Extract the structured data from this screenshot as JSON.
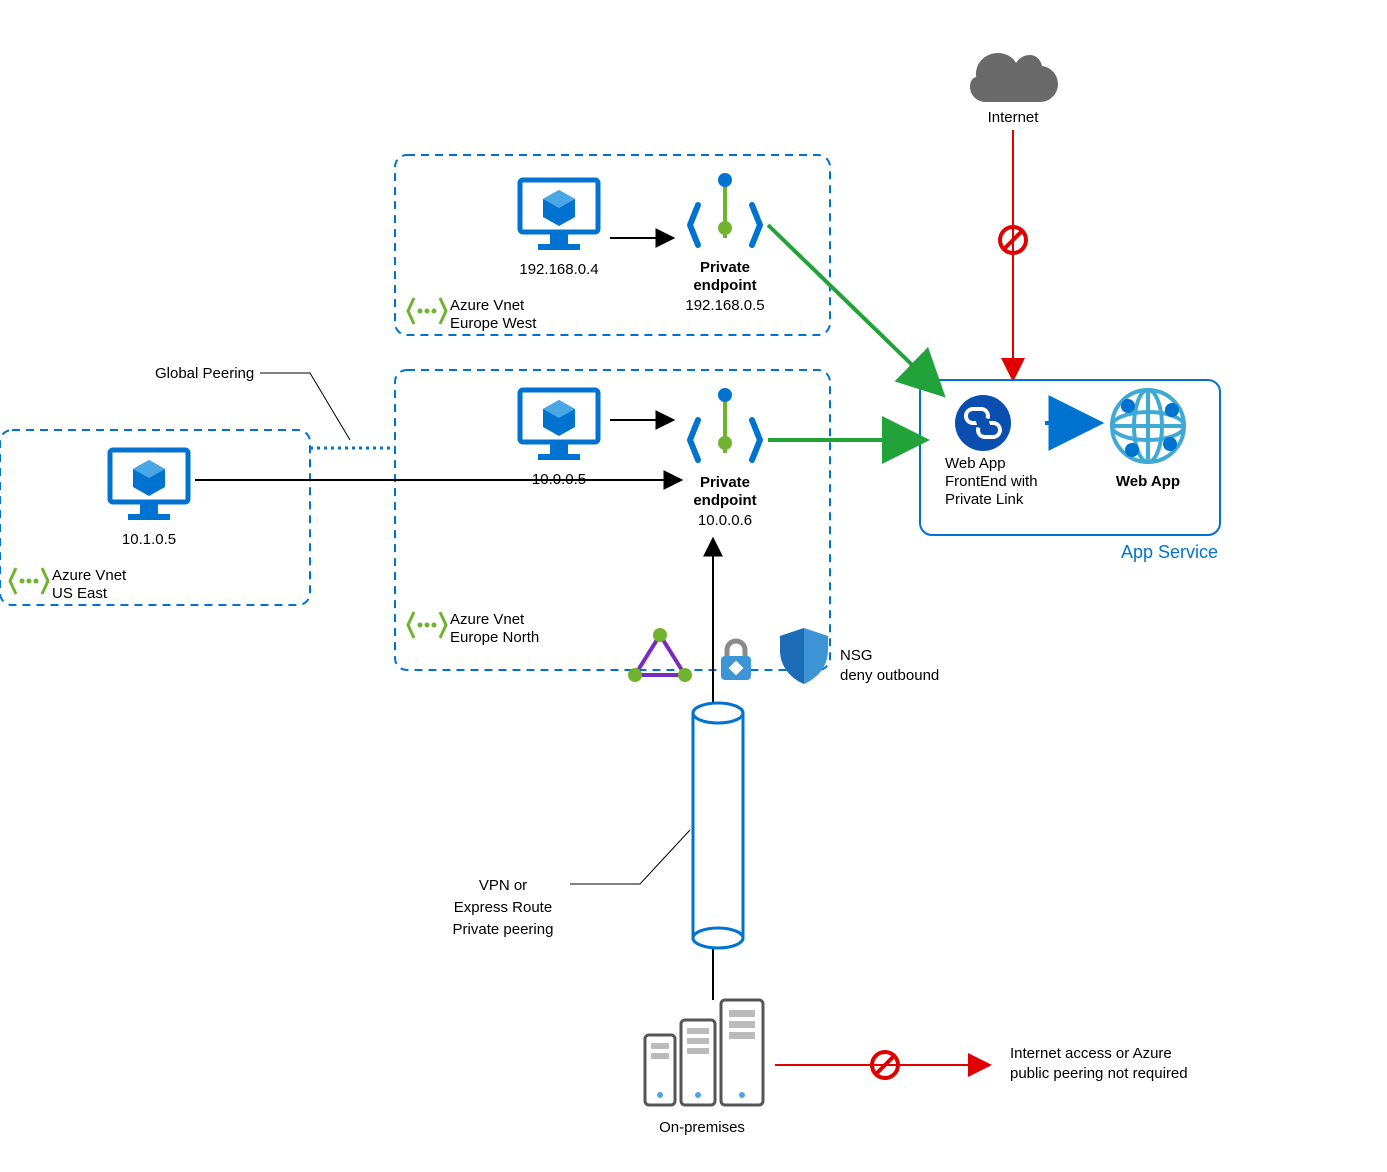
{
  "internet": {
    "label": "Internet"
  },
  "vnet_west": {
    "tag_line1": "Azure Vnet",
    "tag_line2": "Europe West",
    "vm_ip": "192.168.0.4",
    "pe_line1": "Private",
    "pe_line2": "endpoint",
    "pe_ip": "192.168.0.5"
  },
  "vnet_north": {
    "tag_line1": "Azure Vnet",
    "tag_line2": "Europe North",
    "vm_ip": "10.0.0.5",
    "pe_line1": "Private",
    "pe_line2": "endpoint",
    "pe_ip": "10.0.0.6"
  },
  "vnet_east": {
    "tag_line1": "Azure Vnet",
    "tag_line2": "US East",
    "vm_ip": "10.1.0.5"
  },
  "peering": {
    "label": "Global Peering"
  },
  "app_service": {
    "box_label": "App Service",
    "front_line1": "Web App",
    "front_line2": "FrontEnd with",
    "front_line3": "Private Link",
    "app_label": "Web App"
  },
  "nsg": {
    "line1": "NSG",
    "line2": "deny outbound"
  },
  "vpn": {
    "line1": "VPN or",
    "line2": "Express Route",
    "line3": "Private peering"
  },
  "onprem": {
    "label": "On-premises"
  },
  "note": {
    "line1": "Internet access or Azure",
    "line2": "public peering not required"
  }
}
